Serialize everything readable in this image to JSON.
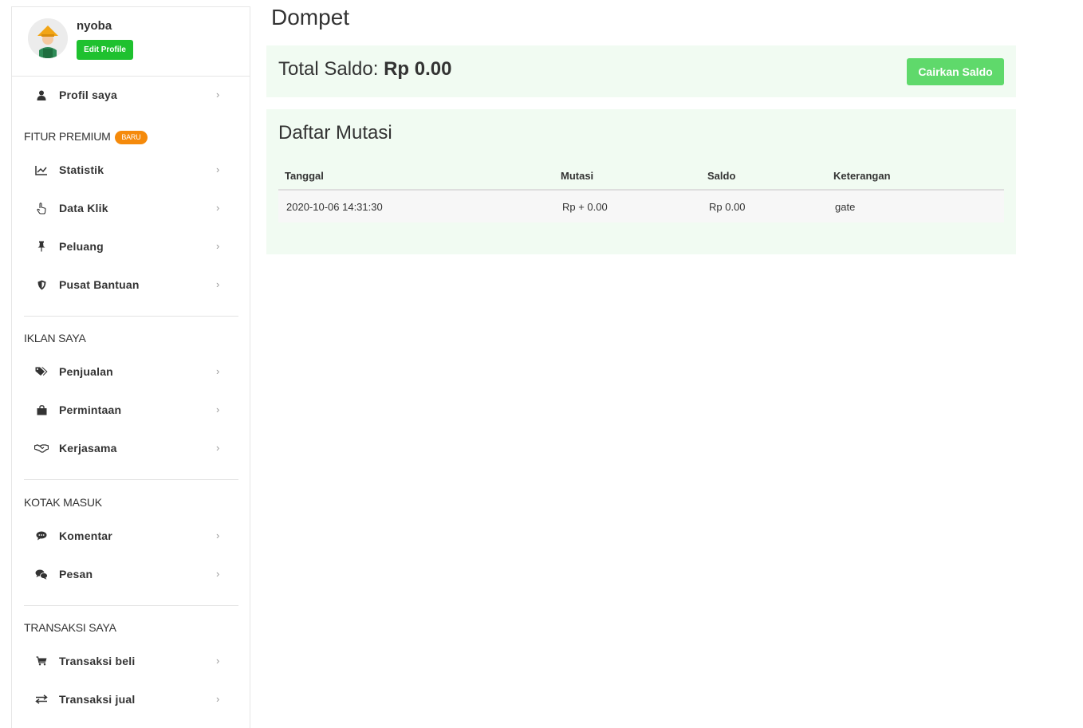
{
  "profile": {
    "name": "nyoba",
    "edit_label": "Edit Profile"
  },
  "menu": {
    "profil": "Profil saya",
    "fitur_title": "FITUR PREMIUM",
    "fitur_badge": "BARU",
    "statistik": "Statistik",
    "data_klik": "Data Klik",
    "peluang": "Peluang",
    "pusat_bantuan": "Pusat Bantuan",
    "iklan_title": "IKLAN SAYA",
    "penjualan": "Penjualan",
    "permintaan": "Permintaan",
    "kerjasama": "Kerjasama",
    "kotak_title": "KOTAK MASUK",
    "komentar": "Komentar",
    "pesan": "Pesan",
    "transaksi_title": "TRANSAKSI SAYA",
    "transaksi_beli": "Transaksi beli",
    "transaksi_jual": "Transaksi jual"
  },
  "page": {
    "title": "Dompet",
    "saldo_label": "Total Saldo:",
    "saldo_value": "Rp 0.00",
    "cairkan_label": "Cairkan Saldo",
    "mutasi_title": "Daftar Mutasi"
  },
  "table": {
    "headers": [
      "Tanggal",
      "Mutasi",
      "Saldo",
      "Keterangan"
    ],
    "rows": [
      [
        "2020-10-06 14:31:30",
        "Rp + 0.00",
        "Rp 0.00",
        "gate"
      ]
    ]
  },
  "colors": {
    "accent": "#1fc12f",
    "cairkan": "#5fd96b",
    "badge": "#f58a0b",
    "panel_bg": "#f1fbf2"
  },
  "icons": [
    "user-icon",
    "chart-line-icon",
    "pointer-hand-icon",
    "thumbtack-icon",
    "shield-icon",
    "tags-icon",
    "shopping-bag-icon",
    "handshake-icon",
    "comment-icon",
    "comments-icon",
    "cart-icon",
    "exchange-icon",
    "chevron-right-icon"
  ]
}
